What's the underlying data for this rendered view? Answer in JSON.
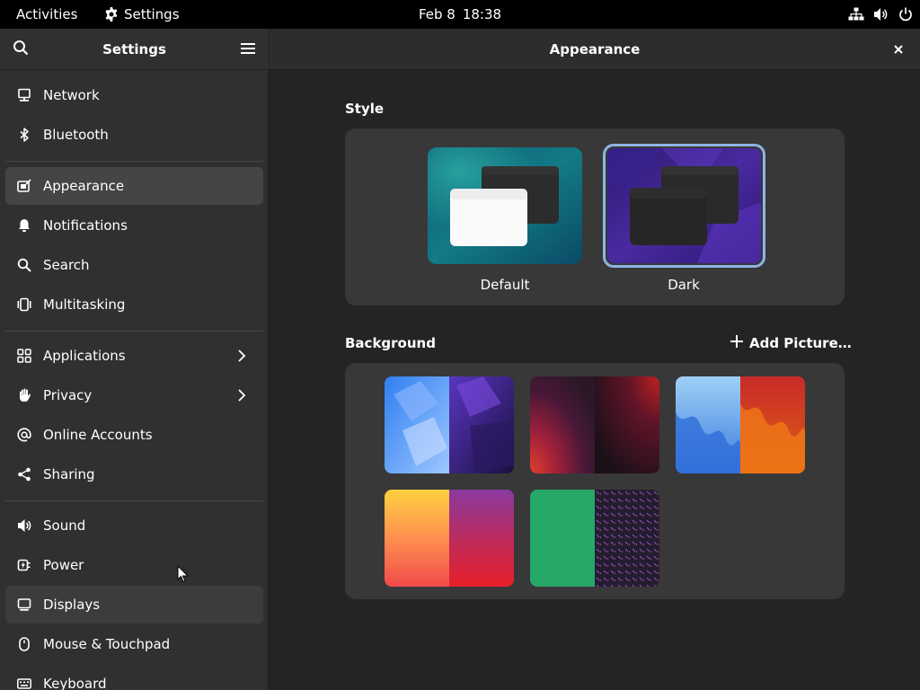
{
  "topbar": {
    "activities": "Activities",
    "app_name": "Settings",
    "date": "Feb 8",
    "time": "18:38"
  },
  "sidebar": {
    "title": "Settings",
    "items": [
      {
        "label": "Network",
        "icon": "network-icon"
      },
      {
        "label": "Bluetooth",
        "icon": "bluetooth-icon"
      },
      {
        "label": "Appearance",
        "icon": "appearance-icon",
        "selected": true
      },
      {
        "label": "Notifications",
        "icon": "bell-icon"
      },
      {
        "label": "Search",
        "icon": "search-icon"
      },
      {
        "label": "Multitasking",
        "icon": "multitasking-icon"
      },
      {
        "label": "Applications",
        "icon": "apps-grid-icon",
        "chevron": true
      },
      {
        "label": "Privacy",
        "icon": "hand-icon",
        "chevron": true
      },
      {
        "label": "Online Accounts",
        "icon": "at-icon"
      },
      {
        "label": "Sharing",
        "icon": "share-icon"
      },
      {
        "label": "Sound",
        "icon": "speaker-icon"
      },
      {
        "label": "Power",
        "icon": "power-plug-icon"
      },
      {
        "label": "Displays",
        "icon": "display-icon",
        "hovered": true
      },
      {
        "label": "Mouse & Touchpad",
        "icon": "mouse-icon"
      },
      {
        "label": "Keyboard",
        "icon": "keyboard-icon"
      }
    ]
  },
  "content": {
    "title": "Appearance",
    "style_section": "Style",
    "style_options": [
      {
        "label": "Default",
        "selected": false
      },
      {
        "label": "Dark",
        "selected": true
      }
    ],
    "background_section": "Background",
    "add_picture": "Add Picture…"
  },
  "colors": {
    "accent": "#8fb3e6",
    "window_bg": "#242424",
    "sidebar_bg": "#303030",
    "card_bg": "#383838"
  }
}
